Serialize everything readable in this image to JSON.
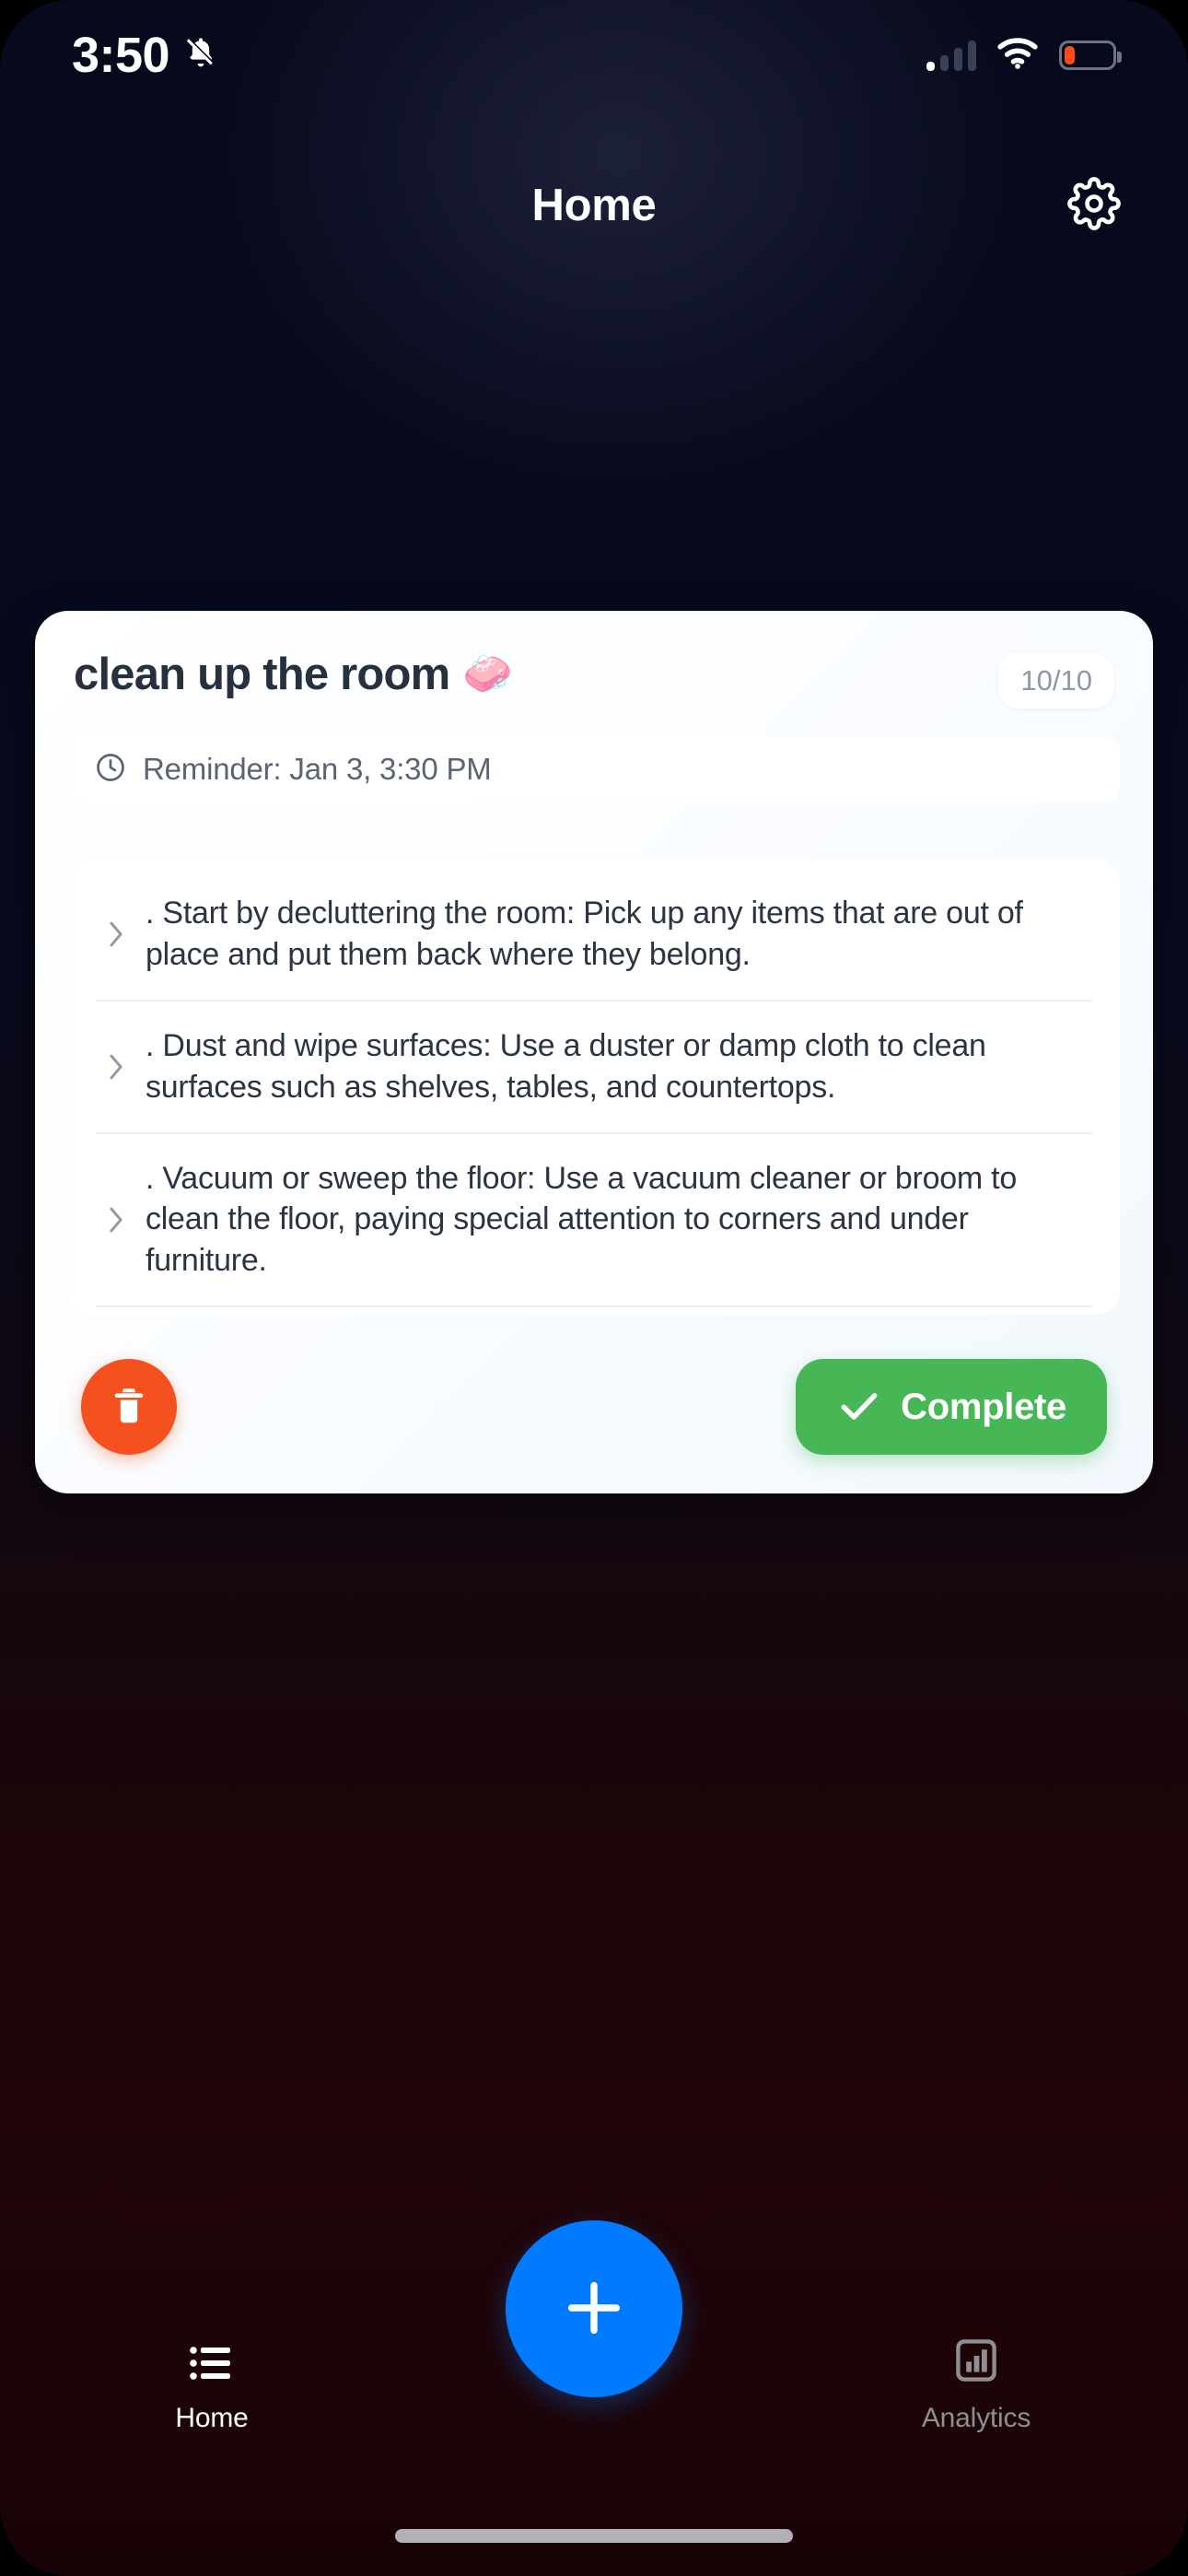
{
  "status_bar": {
    "time": "3:50",
    "silent_icon": "bell-slash-icon",
    "signal_icon": "cellular-signal-icon",
    "wifi_icon": "wifi-icon",
    "battery_icon": "battery-low-icon",
    "battery_level_percent": 22,
    "battery_fill_color": "#ff4d1a"
  },
  "header": {
    "title": "Home",
    "settings_icon": "gear-icon"
  },
  "card": {
    "title": "clean up the room",
    "title_emoji": "🧼",
    "progress_badge": "10/10",
    "reminder": {
      "icon": "clock-icon",
      "text": "Reminder: Jan 3, 3:30 PM"
    },
    "steps": [
      {
        "chevron_icon": "chevron-right-icon",
        "text": ". Start by decluttering the room: Pick up any items that are out of place and put them back where they belong."
      },
      {
        "chevron_icon": "chevron-right-icon",
        "text": ". Dust and wipe surfaces: Use a duster or damp cloth to clean surfaces such as shelves, tables, and countertops."
      },
      {
        "chevron_icon": "chevron-right-icon",
        "text": ". Vacuum or sweep the floor: Use a vacuum cleaner or broom to clean the floor, paying special attention to corners and under furniture."
      }
    ],
    "actions": {
      "delete_icon": "trash-icon",
      "complete_icon": "check-icon",
      "complete_label": "Complete"
    }
  },
  "tab_bar": {
    "home": {
      "label": "Home",
      "icon": "list-icon",
      "active": true
    },
    "add": {
      "icon": "plus-icon"
    },
    "analytics": {
      "label": "Analytics",
      "icon": "bar-chart-icon",
      "active": false
    }
  },
  "colors": {
    "accent_blue": "#007aff",
    "complete_green": "#46b754",
    "delete_orange": "#f4511e",
    "card_white": "#ffffff",
    "bg_top": "#070a1c",
    "bg_bottom": "#1d0407"
  }
}
